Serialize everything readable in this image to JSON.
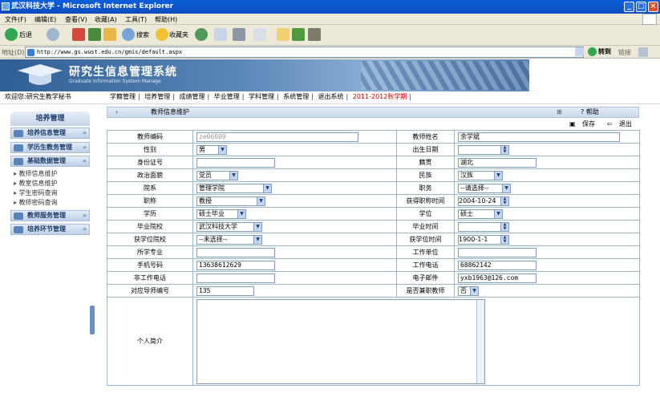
{
  "window": {
    "title": "武汉科技大学 - Microsoft Internet Explorer",
    "min": "_",
    "max": "□",
    "close": "×"
  },
  "menubar": [
    "文件(F)",
    "编辑(E)",
    "查看(V)",
    "收藏(A)",
    "工具(T)",
    "帮助(H)"
  ],
  "toolbar": {
    "back": "后退",
    "search": "搜索",
    "favorites": "收藏夹"
  },
  "address": {
    "label": "地址(D)",
    "url": "http://www.gs.wust.edu.cn/gmis/default.aspx",
    "go": "转到",
    "links": "链接"
  },
  "banner": {
    "title": "研究生信息管理系统",
    "subtitle": "Graduate Information System Manage"
  },
  "nav": {
    "welcome": "欢迎您:研究生教学秘书",
    "links": [
      "学籍管理",
      "培养管理",
      "成绩管理",
      "毕业管理",
      "学科管理",
      "系统管理",
      "退出系统"
    ],
    "term": "2011-2012秋学期"
  },
  "sidebar": {
    "header": "培养管理",
    "groups": [
      "培养信息管理",
      "学历生教务管理",
      "基础数据管理",
      "教师服务管理",
      "培养环节管理"
    ],
    "items": [
      "教师信息维护",
      "教室信息维护",
      "学生密码查询",
      "教师密码查询"
    ]
  },
  "content": {
    "header": "教师信息维护",
    "help": "帮助",
    "save": "保存",
    "back": "退出"
  },
  "form": {
    "teacher_id_label": "教师编码",
    "teacher_id": "ze06009",
    "teacher_name_label": "教师姓名",
    "teacher_name": "余学斌",
    "gender_label": "性别",
    "gender": "男",
    "birth_label": "出生日期",
    "birth": "",
    "idcard_label": "身份证号",
    "idcard": "",
    "native_label": "籍贯",
    "native": "湖北",
    "political_label": "政治面貌",
    "political": "党员",
    "ethnic_label": "民族",
    "ethnic": "汉族",
    "dept_label": "院系",
    "dept": "管理学院",
    "post_label": "职务",
    "post": "--请选择--",
    "title_label": "职称",
    "title": "教授",
    "title_time_label": "获得职称时间",
    "title_time": "2004-10-24",
    "education_label": "学历",
    "education": "硕士毕业",
    "degree_label": "学位",
    "degree": "硕士",
    "grad_school_label": "毕业院校",
    "grad_school": "武汉科技大学",
    "grad_time_label": "毕业时间",
    "grad_time": "",
    "degree_school_label": "获学位院校",
    "degree_school": "--未选择--",
    "degree_time_label": "获学位时间",
    "degree_time": "1900-1-1",
    "major_label": "所学专业",
    "major": "",
    "work_unit_label": "工作单位",
    "work_unit": "",
    "mobile_label": "手机号码",
    "mobile": "13638612629",
    "work_phone_label": "工作电话",
    "work_phone": "68862142",
    "nonwork_phone_label": "非工作电话",
    "nonwork_phone": "",
    "email_label": "电子邮件",
    "email": "yxb1963@126.com",
    "advisor_no_label": "对应导师编号",
    "advisor_no": "135",
    "parttime_label": "是否兼职教师",
    "parttime": "否",
    "intro_label": "个人简介",
    "intro": ""
  }
}
